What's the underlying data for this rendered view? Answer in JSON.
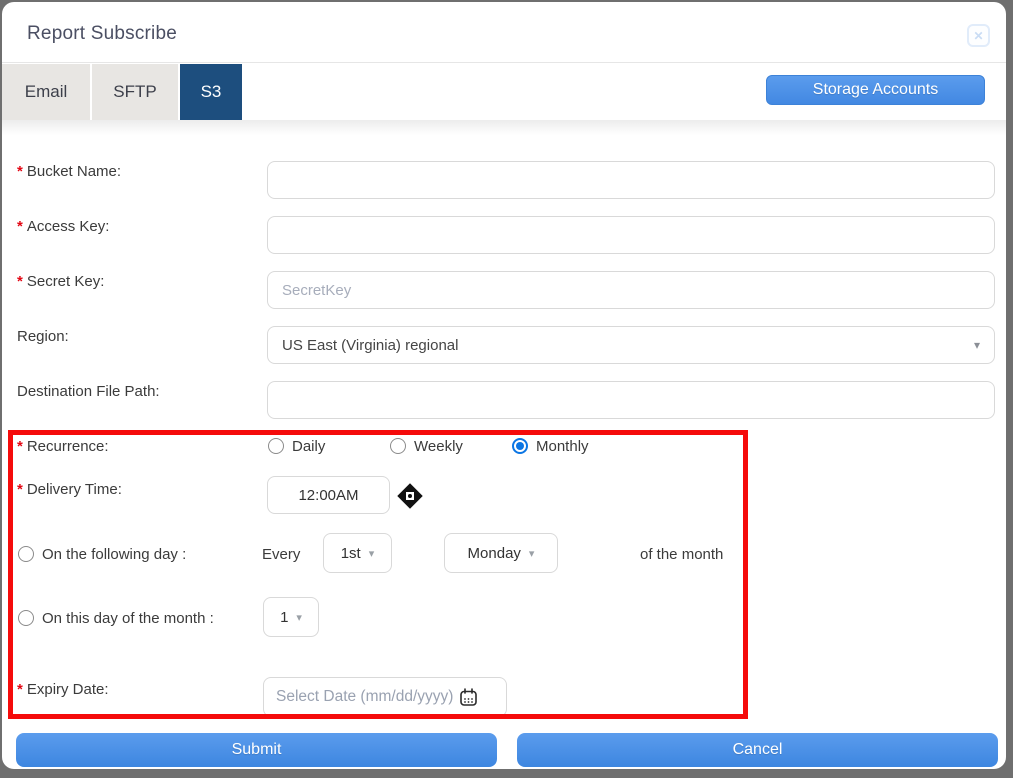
{
  "dialog": {
    "title": "Report Subscribe"
  },
  "icons": {
    "close": "✕",
    "chevron_down": "▾"
  },
  "required_marker": "*",
  "tabs": [
    {
      "label": "Email",
      "active": false
    },
    {
      "label": "SFTP",
      "active": false
    },
    {
      "label": "S3",
      "active": true
    }
  ],
  "storage_accounts_button": "Storage Accounts",
  "form": {
    "bucket_name": {
      "label": "Bucket Name:",
      "required": true,
      "value": ""
    },
    "access_key": {
      "label": "Access Key:",
      "required": true,
      "value": ""
    },
    "secret_key": {
      "label": "Secret Key:",
      "required": true,
      "value": "",
      "placeholder": "SecretKey"
    },
    "region": {
      "label": "Region:",
      "required": false,
      "value": "US East (Virginia) regional"
    },
    "destination_file_path": {
      "label": "Destination File Path:",
      "required": false,
      "value": ""
    },
    "recurrence": {
      "label": "Recurrence:",
      "required": true,
      "options": [
        "Daily",
        "Weekly",
        "Monthly"
      ],
      "selected": "Monthly"
    },
    "delivery_time": {
      "label": "Delivery Time:",
      "required": true,
      "value": "12:00AM"
    },
    "following_day": {
      "label": "On the following day :",
      "selected": false,
      "prefix": "Every",
      "ordinal": "1st",
      "weekday": "Monday",
      "suffix": "of the month"
    },
    "day_of_month": {
      "label": "On this day of the month :",
      "selected": false,
      "day": "1"
    },
    "expiry_date": {
      "label": "Expiry Date:",
      "required": true,
      "placeholder": "Select Date (mm/dd/yyyy)"
    }
  },
  "footer": {
    "submit_label": "Submit",
    "cancel_label": "Cancel"
  },
  "colors": {
    "accent_blue": "#4a90e2",
    "active_tab_blue": "#1d4e7e",
    "inactive_tab_gray": "#e8e6e3",
    "highlight_red": "#f50b0b",
    "required_red": "#e30613",
    "title_gray": "#4b4f63"
  }
}
